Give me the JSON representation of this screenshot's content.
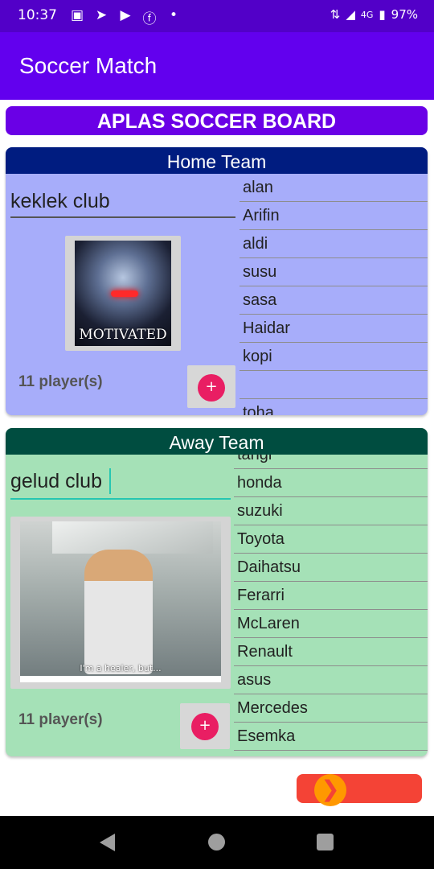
{
  "status_bar": {
    "time": "10:37",
    "network": "4G",
    "battery": "97%",
    "icons": [
      "gallery-icon",
      "telegram-icon",
      "youtube-icon",
      "facebook-icon",
      "dot-icon"
    ]
  },
  "app_bar": {
    "title": "Soccer Match"
  },
  "board_title": "APLAS SOCCER BOARD",
  "home": {
    "header": "Home Team",
    "team_name": "keklek club",
    "logo_caption": "MOTIVATED",
    "player_count": "11 player(s)",
    "add_label": "+",
    "players": [
      "alan",
      "Arifin",
      "aldi",
      "susu",
      "sasa",
      "Haidar",
      "kopi",
      "",
      "toha"
    ],
    "colors": {
      "header": "#001c80",
      "body": "#a7adfa"
    }
  },
  "away": {
    "header": "Away Team",
    "team_name": "gelud club",
    "logo_caption": "I'm a healer, but...",
    "player_count": "11 player(s)",
    "add_label": "+",
    "players": [
      "tangi",
      "honda",
      "suzuki",
      "Toyota",
      "Daihatsu",
      "Ferarri",
      "McLaren",
      "Renault",
      "asus",
      "Mercedes",
      "Esemka"
    ],
    "colors": {
      "header": "#004d40",
      "body": "#a5e1b7"
    }
  },
  "next_button": {
    "icon": "chevron-right-icon",
    "glyph": "❯"
  },
  "colors": {
    "status_bar": "#5200c8",
    "app_bar": "#6200ee",
    "fab": "#e91e63",
    "next_button": "#f44336"
  }
}
